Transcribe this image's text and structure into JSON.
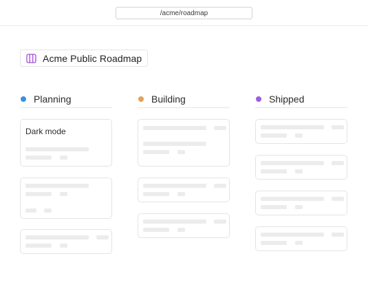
{
  "browser": {
    "url": "/acme/roadmap"
  },
  "board": {
    "title": "Acme Public Roadmap",
    "icon": "map-icon",
    "icon_color": "#a24bd6"
  },
  "columns": [
    {
      "label": "Planning",
      "dot_color": "#3d8fdc"
    },
    {
      "label": "Building",
      "dot_color": "#e3a25a"
    },
    {
      "label": "Shipped",
      "dot_color": "#9d5ce0"
    }
  ],
  "cards": {
    "planning_first_title": "Dark mode"
  },
  "colors": {
    "placeholder": "#ececec",
    "border": "#e3e3e3"
  }
}
